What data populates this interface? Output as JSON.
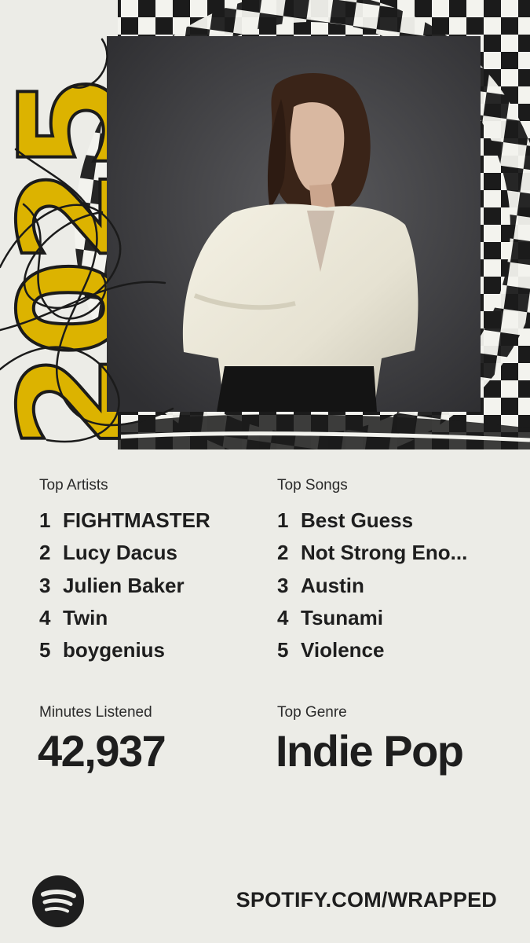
{
  "art": {
    "year": "2025",
    "year_color": "#dcb300",
    "photo_description_icon": "artist-photo"
  },
  "top_artists": {
    "label": "Top Artists",
    "items": [
      {
        "rank": "1",
        "name": "FIGHTMASTER"
      },
      {
        "rank": "2",
        "name": "Lucy Dacus"
      },
      {
        "rank": "3",
        "name": "Julien Baker"
      },
      {
        "rank": "4",
        "name": "Twin"
      },
      {
        "rank": "5",
        "name": "boygenius"
      }
    ]
  },
  "top_songs": {
    "label": "Top Songs",
    "items": [
      {
        "rank": "1",
        "name": "Best Guess"
      },
      {
        "rank": "2",
        "name": "Not Strong Eno..."
      },
      {
        "rank": "3",
        "name": "Austin"
      },
      {
        "rank": "4",
        "name": "Tsunami"
      },
      {
        "rank": "5",
        "name": "Violence"
      }
    ]
  },
  "minutes": {
    "label": "Minutes Listened",
    "value": "42,937"
  },
  "genre": {
    "label": "Top Genre",
    "value": "Indie Pop"
  },
  "footer": {
    "logo_icon": "spotify-logo-icon",
    "url": "SPOTIFY.COM/WRAPPED"
  },
  "colors": {
    "background": "#ecece7",
    "text": "#1e1e1e",
    "accent_yellow": "#dcb300",
    "checker_dark": "#1b1b1b"
  }
}
